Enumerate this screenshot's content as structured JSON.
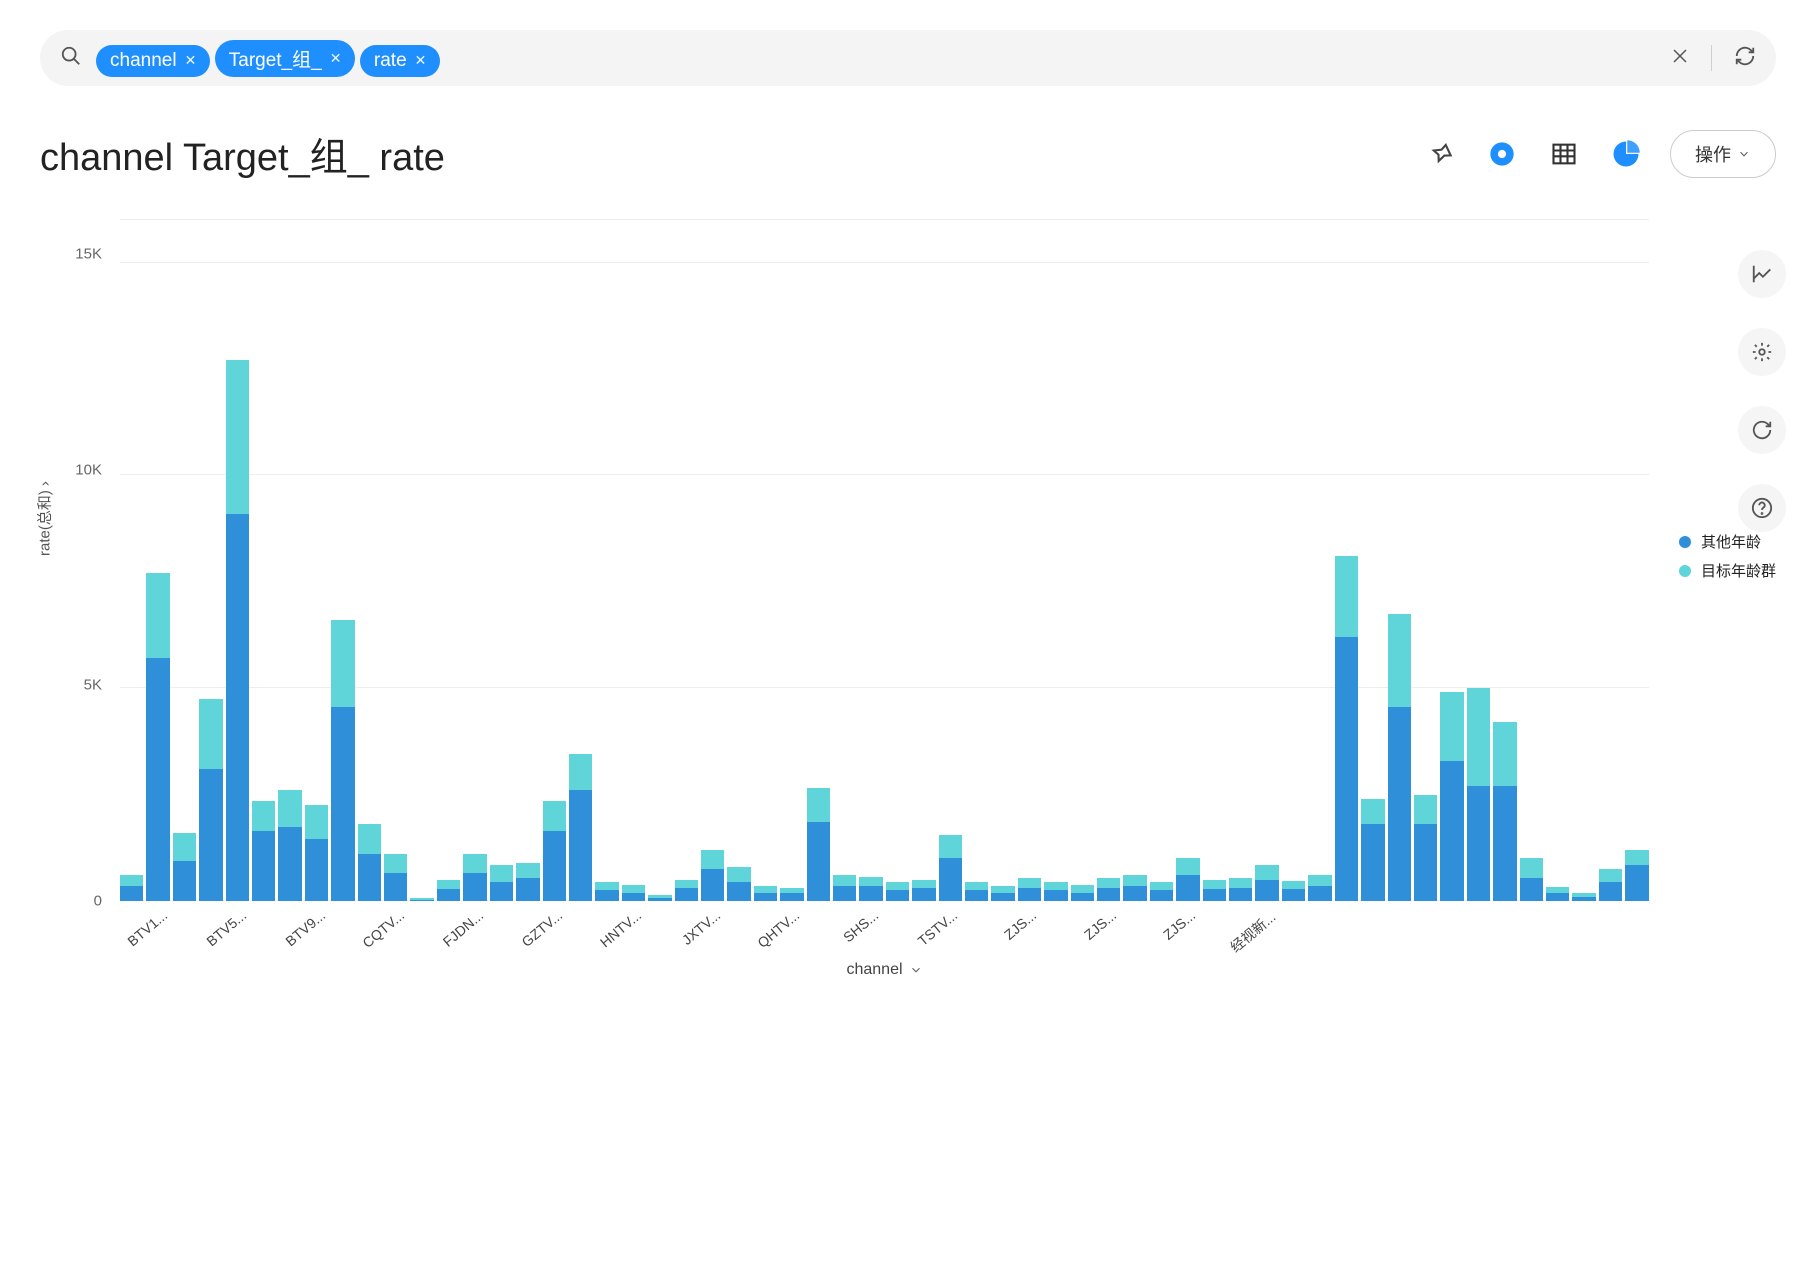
{
  "search": {
    "chips": [
      "channel",
      "Target_组_",
      "rate"
    ]
  },
  "title": "channel Target_组_ rate",
  "action_label": "操作",
  "chart_data": {
    "type": "bar",
    "stacked": true,
    "ylabel": "rate(总和)",
    "xlabel": "channel",
    "ylim": [
      0,
      16000
    ],
    "yticks": [
      0,
      5000,
      10000,
      15000
    ],
    "ytick_labels": [
      "0",
      "5K",
      "10K",
      "15K"
    ],
    "series": [
      {
        "name": "其他年龄",
        "color": "#2f8fd8"
      },
      {
        "name": "目标年龄群",
        "color": "#5fd4d9"
      }
    ],
    "categories": [
      "",
      "BTV1...",
      "",
      "",
      "BTV5...",
      "",
      "",
      "BTV9...",
      "",
      "",
      "CQTV...",
      "",
      "",
      "FJDN...",
      "",
      "",
      "GZTV...",
      "",
      "",
      "HNTV...",
      "",
      "",
      "JXTV...",
      "",
      "",
      "QHTV...",
      "",
      "",
      "SHS...",
      "",
      "",
      "TSTV...",
      "",
      "",
      "ZJS...",
      "",
      "",
      "ZJS...",
      "",
      "",
      "ZJS...",
      "",
      "",
      "经视新...",
      ""
    ],
    "bars": [
      {
        "s1": 350,
        "s2": 250
      },
      {
        "s1": 5700,
        "s2": 2000
      },
      {
        "s1": 950,
        "s2": 650
      },
      {
        "s1": 3100,
        "s2": 1650
      },
      {
        "s1": 9100,
        "s2": 3600
      },
      {
        "s1": 1650,
        "s2": 700
      },
      {
        "s1": 1750,
        "s2": 850
      },
      {
        "s1": 1450,
        "s2": 800
      },
      {
        "s1": 4550,
        "s2": 2050
      },
      {
        "s1": 1100,
        "s2": 700
      },
      {
        "s1": 650,
        "s2": 450
      },
      {
        "s1": 30,
        "s2": 30
      },
      {
        "s1": 280,
        "s2": 220
      },
      {
        "s1": 650,
        "s2": 450
      },
      {
        "s1": 450,
        "s2": 400
      },
      {
        "s1": 550,
        "s2": 350
      },
      {
        "s1": 1650,
        "s2": 700
      },
      {
        "s1": 2600,
        "s2": 850
      },
      {
        "s1": 250,
        "s2": 200
      },
      {
        "s1": 200,
        "s2": 180
      },
      {
        "s1": 80,
        "s2": 70
      },
      {
        "s1": 300,
        "s2": 200
      },
      {
        "s1": 750,
        "s2": 450
      },
      {
        "s1": 450,
        "s2": 350
      },
      {
        "s1": 200,
        "s2": 150
      },
      {
        "s1": 180,
        "s2": 120
      },
      {
        "s1": 1850,
        "s2": 800
      },
      {
        "s1": 350,
        "s2": 250
      },
      {
        "s1": 350,
        "s2": 220
      },
      {
        "s1": 250,
        "s2": 200
      },
      {
        "s1": 300,
        "s2": 200
      },
      {
        "s1": 1000,
        "s2": 550
      },
      {
        "s1": 250,
        "s2": 200
      },
      {
        "s1": 200,
        "s2": 150
      },
      {
        "s1": 300,
        "s2": 250
      },
      {
        "s1": 250,
        "s2": 200
      },
      {
        "s1": 200,
        "s2": 180
      },
      {
        "s1": 300,
        "s2": 250
      },
      {
        "s1": 350,
        "s2": 250
      },
      {
        "s1": 250,
        "s2": 200
      },
      {
        "s1": 600,
        "s2": 400
      },
      {
        "s1": 280,
        "s2": 220
      },
      {
        "s1": 300,
        "s2": 250
      },
      {
        "s1": 500,
        "s2": 350
      },
      {
        "s1": 280,
        "s2": 200
      },
      {
        "s1": 350,
        "s2": 250
      },
      {
        "s1": 6200,
        "s2": 1900
      },
      {
        "s1": 1800,
        "s2": 600
      },
      {
        "s1": 4550,
        "s2": 2200
      },
      {
        "s1": 1800,
        "s2": 700
      },
      {
        "s1": 3300,
        "s2": 1600
      },
      {
        "s1": 2700,
        "s2": 2300
      },
      {
        "s1": 2700,
        "s2": 1500
      },
      {
        "s1": 550,
        "s2": 450
      },
      {
        "s1": 180,
        "s2": 150
      },
      {
        "s1": 100,
        "s2": 100
      },
      {
        "s1": 450,
        "s2": 300
      },
      {
        "s1": 850,
        "s2": 350
      }
    ]
  },
  "legend": [
    {
      "label": "其他年龄",
      "color": "#2f8fd8"
    },
    {
      "label": "目标年龄群",
      "color": "#5fd4d9"
    }
  ]
}
